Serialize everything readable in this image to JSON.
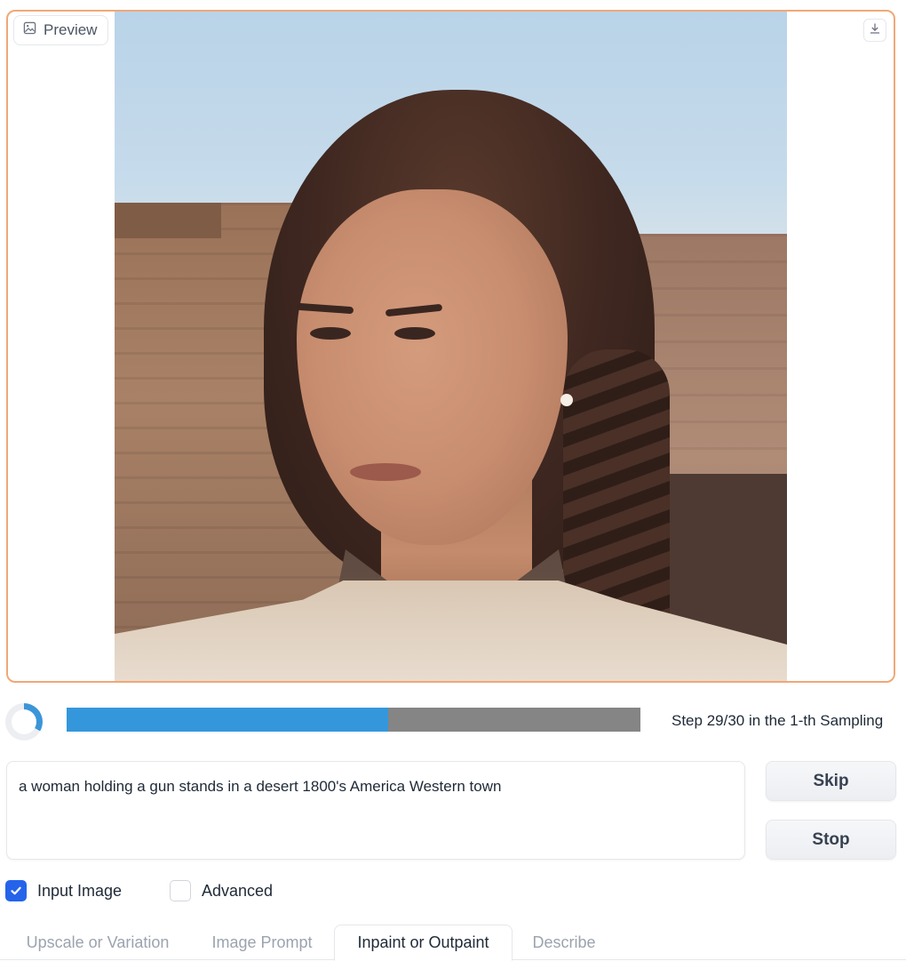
{
  "preview": {
    "label": "Preview",
    "label_icon": "image-icon",
    "download_icon": "download-icon"
  },
  "progress": {
    "percent": 56,
    "status_text": "Step 29/30 in the 1-th Sampling"
  },
  "prompt": {
    "value": "a woman holding a gun stands in a desert 1800's America Western town"
  },
  "buttons": {
    "skip": "Skip",
    "stop": "Stop"
  },
  "checkboxes": [
    {
      "label": "Input Image",
      "checked": true
    },
    {
      "label": "Advanced",
      "checked": false
    }
  ],
  "tabs": [
    {
      "label": "Upscale or Variation",
      "active": false
    },
    {
      "label": "Image Prompt",
      "active": false
    },
    {
      "label": "Inpaint or Outpaint",
      "active": true
    },
    {
      "label": "Describe",
      "active": false
    }
  ],
  "colors": {
    "panel_border": "#f0a878",
    "progress_fill": "#3497db",
    "progress_track": "#858585",
    "checkbox_checked": "#2563eb"
  }
}
